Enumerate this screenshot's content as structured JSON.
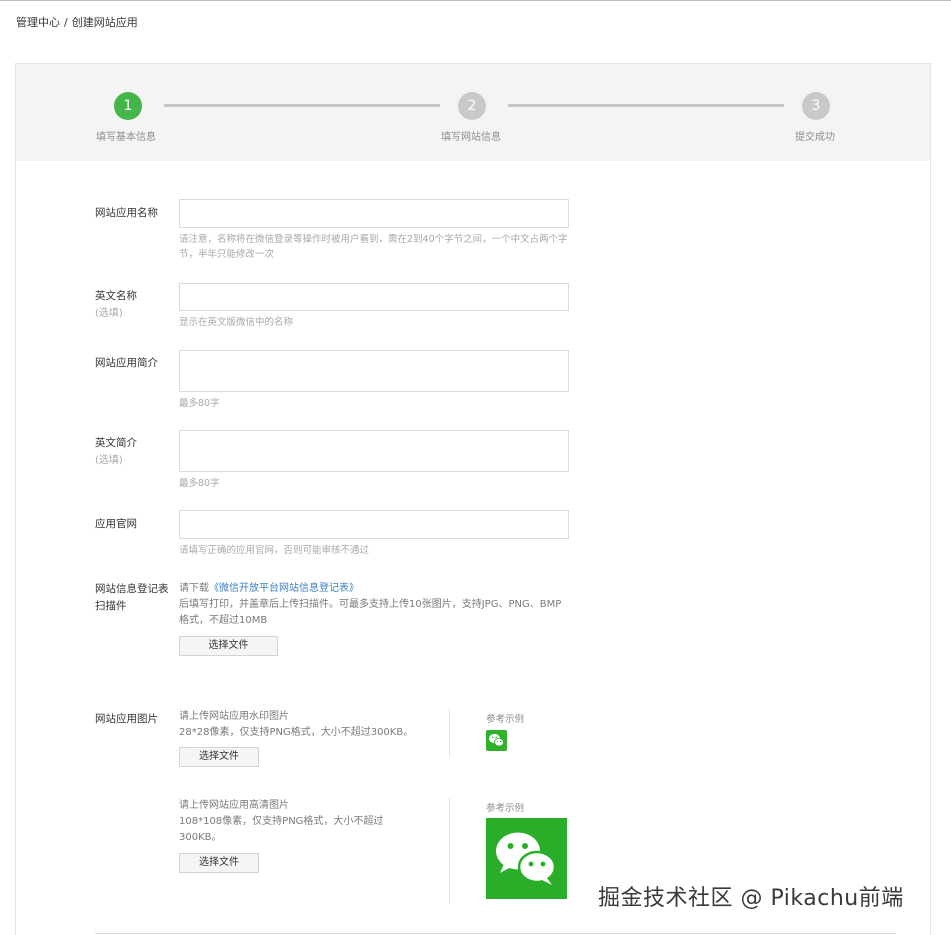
{
  "breadcrumb": {
    "root": "管理中心",
    "separator": "/",
    "current": "创建网站应用"
  },
  "steps": [
    {
      "number": "1",
      "label": "填写基本信息",
      "active": true
    },
    {
      "number": "2",
      "label": "填写网站信息",
      "active": false
    },
    {
      "number": "3",
      "label": "提交成功",
      "active": false
    }
  ],
  "colors": {
    "active_step": "#44b549",
    "inactive_step": "#c9c9c9",
    "link": "#3a7fc5",
    "wechat_green": "#2aae29"
  },
  "form": {
    "app_name": {
      "label": "网站应用名称",
      "value": "",
      "hint": "请注意，名称将在微信登录等操作时被用户看到，需在2到40个字节之间，一个中文占两个字节，半年只能修改一次"
    },
    "en_name": {
      "label": "英文名称",
      "optional": "(选填)",
      "value": "",
      "hint": "显示在英文版微信中的名称"
    },
    "intro": {
      "label": "网站应用简介",
      "value": "",
      "hint": "最多80字"
    },
    "en_intro": {
      "label": "英文简介",
      "optional": "(选填)",
      "value": "",
      "hint": "最多80字"
    },
    "website": {
      "label": "应用官网",
      "value": "",
      "hint": "请填写正确的应用官网，否则可能审核不通过"
    },
    "registration": {
      "label_line1": "网站信息登记表",
      "label_line2": "扫描件",
      "hint_prefix": "请下载",
      "hint_link": "《微信开放平台网站信息登记表》",
      "hint_body": "后填写打印，并盖章后上传扫描件。可最多支持上传10张图片，支持JPG、PNG、BMP格式，不超过10MB",
      "button": "选择文件"
    },
    "app_image": {
      "label": "网站应用图片",
      "small": {
        "title": "请上传网站应用水印图片",
        "spec": "28*28像素，仅支持PNG格式，大小不超过300KB。",
        "button": "选择文件",
        "ref_label": "参考示例",
        "ref_icon": "wechat-logo-icon"
      },
      "large": {
        "title": "请上传网站应用高清图片",
        "spec": "108*108像素，仅支持PNG格式，大小不超过300KB。",
        "button": "选择文件",
        "ref_label": "参考示例",
        "ref_icon": "wechat-logo-icon"
      }
    }
  },
  "watermark": "掘金技术社区 @ Pikachu前端"
}
